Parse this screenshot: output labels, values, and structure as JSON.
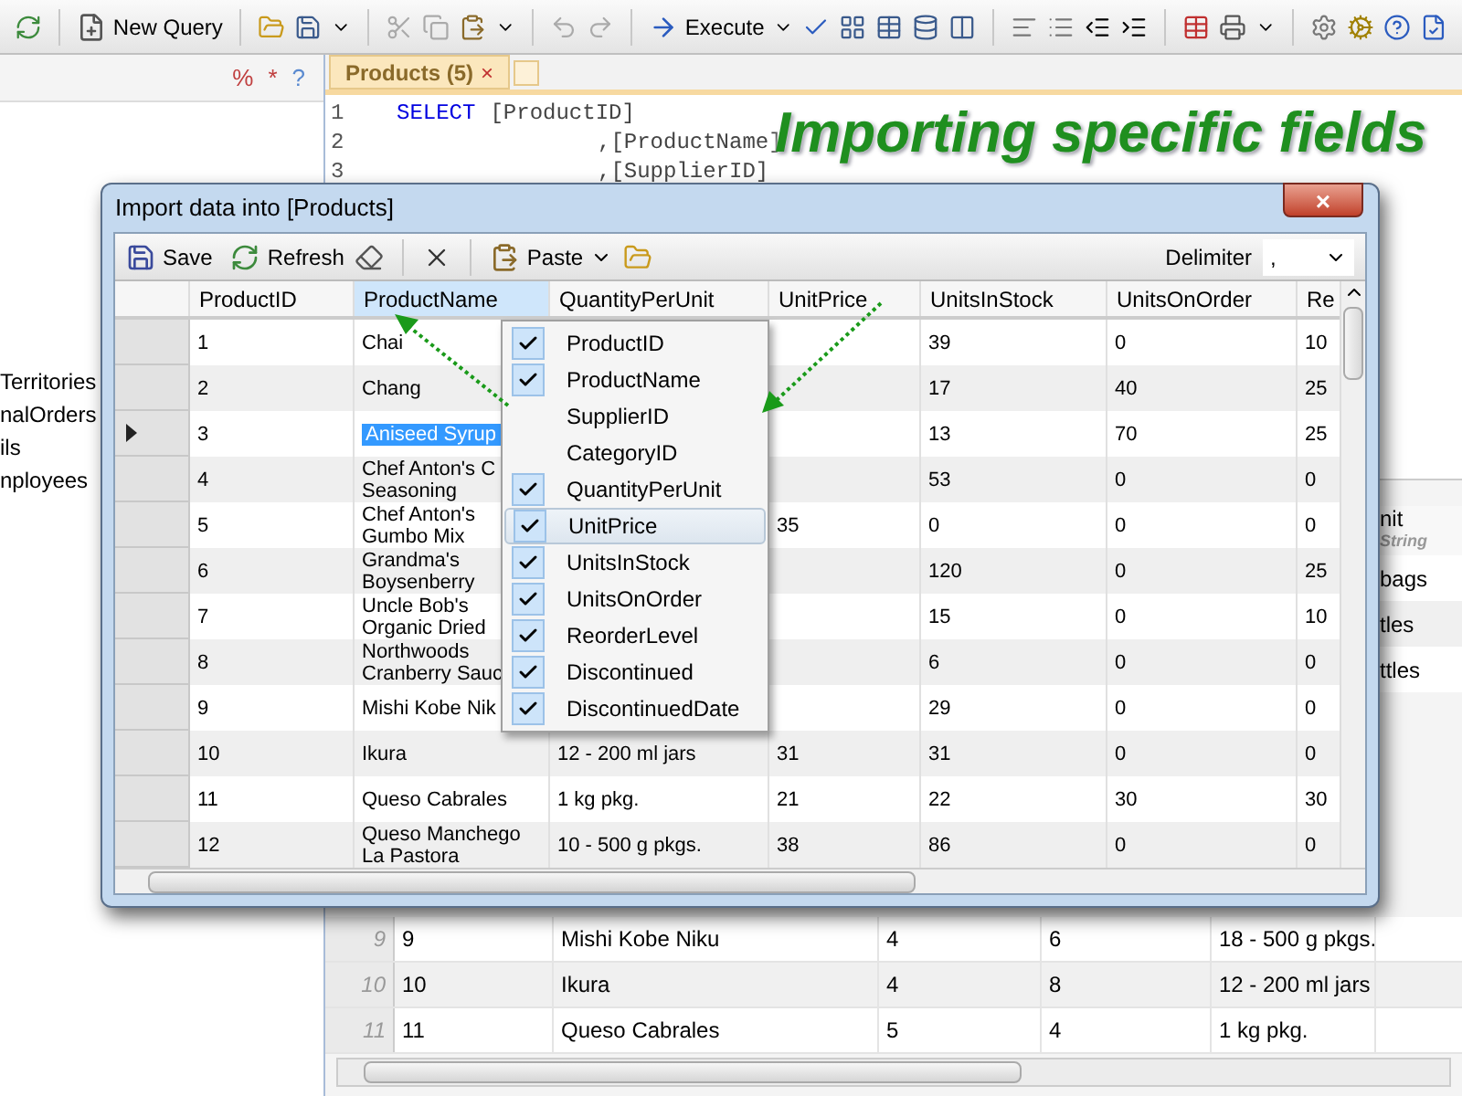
{
  "toolbar": {
    "new_query": "New Query",
    "execute": "Execute"
  },
  "explorer": {
    "tools": [
      "%",
      "*",
      "?"
    ],
    "items": [
      "Territories",
      "nalOrders",
      "ils",
      "nployees"
    ]
  },
  "editor": {
    "tab": {
      "title": "Products (5)",
      "close": "×"
    },
    "lines": [
      {
        "number": "1",
        "keyword": "SELECT",
        "text": "[ProductID]"
      },
      {
        "number": "2",
        "text": ",[ProductName]"
      },
      {
        "number": "3",
        "text": ",[SupplierID]"
      }
    ]
  },
  "banner": "Importing specific fields",
  "results_grid": {
    "header_tail": "nit",
    "header_tail_type": "String",
    "tail_cells": [
      "bags",
      "tles",
      "ttles"
    ],
    "rows": [
      {
        "number": "9",
        "cells": [
          "9",
          "Mishi Kobe Niku",
          "4",
          "6",
          "18 - 500 g pkgs."
        ]
      },
      {
        "number": "10",
        "cells": [
          "10",
          "Ikura",
          "4",
          "8",
          "12 - 200 ml jars"
        ]
      },
      {
        "number": "11",
        "cells": [
          "11",
          "Queso Cabrales",
          "5",
          "4",
          "1 kg pkg."
        ]
      }
    ]
  },
  "dialog": {
    "title": "Import data into [Products]",
    "close": "×",
    "toolbar": {
      "save": "Save",
      "refresh": "Refresh",
      "paste": "Paste",
      "delimiter_label": "Delimiter",
      "delimiter_value": ","
    },
    "columns": [
      {
        "label": "ProductID",
        "selected": false
      },
      {
        "label": "ProductName",
        "selected": true
      },
      {
        "label": "QuantityPerUnit",
        "selected": false
      },
      {
        "label": "UnitPrice",
        "selected": false
      },
      {
        "label": "UnitsInStock",
        "selected": false
      },
      {
        "label": "UnitsOnOrder",
        "selected": false
      },
      {
        "label": "Re",
        "selected": false
      }
    ],
    "rows": [
      {
        "current": false,
        "cells": [
          "1",
          "Chai",
          null,
          null,
          "39",
          "0",
          "10"
        ]
      },
      {
        "current": false,
        "cells": [
          "2",
          "Chang",
          null,
          null,
          "17",
          "40",
          "25"
        ]
      },
      {
        "current": true,
        "cells": [
          "3",
          "Aniseed Syrup",
          null,
          null,
          "13",
          "70",
          "25"
        ]
      },
      {
        "current": false,
        "cells": [
          "4",
          "Chef Anton's C\nSeasoning",
          null,
          null,
          "53",
          "0",
          "0"
        ]
      },
      {
        "current": false,
        "cells": [
          "5",
          "Chef Anton's\nGumbo Mix",
          null,
          "35",
          "0",
          "0",
          "0"
        ]
      },
      {
        "current": false,
        "cells": [
          "6",
          "Grandma's\nBoysenberry",
          null,
          null,
          "120",
          "0",
          "25"
        ]
      },
      {
        "current": false,
        "cells": [
          "7",
          "Uncle Bob's\nOrganic Dried",
          null,
          null,
          "15",
          "0",
          "10"
        ]
      },
      {
        "current": false,
        "cells": [
          "8",
          "Northwoods\nCranberry Sauc",
          null,
          null,
          "6",
          "0",
          "0"
        ]
      },
      {
        "current": false,
        "cells": [
          "9",
          "Mishi Kobe Nik",
          null,
          null,
          "29",
          "0",
          "0"
        ]
      },
      {
        "current": false,
        "cells": [
          "10",
          "Ikura",
          "12 - 200 ml jars",
          "31",
          "31",
          "0",
          "0"
        ]
      },
      {
        "current": false,
        "cells": [
          "11",
          "Queso Cabrales",
          "1 kg pkg.",
          "21",
          "22",
          "30",
          "30"
        ]
      },
      {
        "current": false,
        "cells": [
          "12",
          "Queso Manchego\nLa Pastora",
          "10 - 500 g pkgs.",
          "38",
          "86",
          "0",
          "0"
        ]
      }
    ],
    "column_menu": [
      {
        "label": "ProductID",
        "checked": true,
        "selected": false
      },
      {
        "label": "ProductName",
        "checked": true,
        "selected": false
      },
      {
        "label": "SupplierID",
        "checked": false,
        "selected": false
      },
      {
        "label": "CategoryID",
        "checked": false,
        "selected": false
      },
      {
        "label": "QuantityPerUnit",
        "checked": true,
        "selected": false
      },
      {
        "label": "UnitPrice",
        "checked": true,
        "selected": true
      },
      {
        "label": "UnitsInStock",
        "checked": true,
        "selected": false
      },
      {
        "label": "UnitsOnOrder",
        "checked": true,
        "selected": false
      },
      {
        "label": "ReorderLevel",
        "checked": true,
        "selected": false
      },
      {
        "label": "Discontinued",
        "checked": true,
        "selected": false
      },
      {
        "label": "DiscontinuedDate",
        "checked": true,
        "selected": false
      }
    ]
  }
}
